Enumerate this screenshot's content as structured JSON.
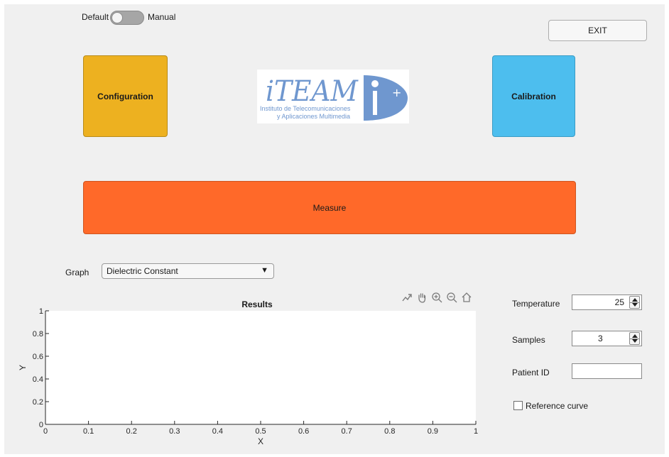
{
  "mode_toggle": {
    "left_label": "Default",
    "right_label": "Manual",
    "state": "Default"
  },
  "buttons": {
    "exit": "EXIT",
    "configuration": "Configuration",
    "calibration": "Calibration",
    "measure": "Measure"
  },
  "logo": {
    "wordmark": "iTEAM",
    "line1": "Instituto de Telecomunicaciones",
    "line2": "y Aplicaciones Multimedia"
  },
  "graph": {
    "label": "Graph",
    "selected": "Dielectric Constant"
  },
  "chart_data": {
    "type": "line",
    "title": "Results",
    "xlabel": "X",
    "ylabel": "Y",
    "xlim": [
      0,
      1
    ],
    "ylim": [
      0,
      1
    ],
    "xticks": [
      "0",
      "0.1",
      "0.2",
      "0.3",
      "0.4",
      "0.5",
      "0.6",
      "0.7",
      "0.8",
      "0.9",
      "1"
    ],
    "yticks": [
      "0",
      "0.2",
      "0.4",
      "0.6",
      "0.8",
      "1"
    ],
    "series": [],
    "grid": false
  },
  "chart_toolbar": [
    "export-icon",
    "pan-icon",
    "zoom-in-icon",
    "zoom-out-icon",
    "home-icon"
  ],
  "controls": {
    "temperature": {
      "label": "Temperature",
      "value": "25"
    },
    "samples": {
      "label": "Samples",
      "value": "3"
    },
    "patient_id": {
      "label": "Patient ID",
      "value": ""
    },
    "reference_curve": {
      "label": "Reference curve",
      "checked": false
    }
  },
  "colors": {
    "configuration": "#edb120",
    "calibration": "#4dbeee",
    "measure": "#ff6929",
    "logo_blue": "#6f97cf"
  }
}
